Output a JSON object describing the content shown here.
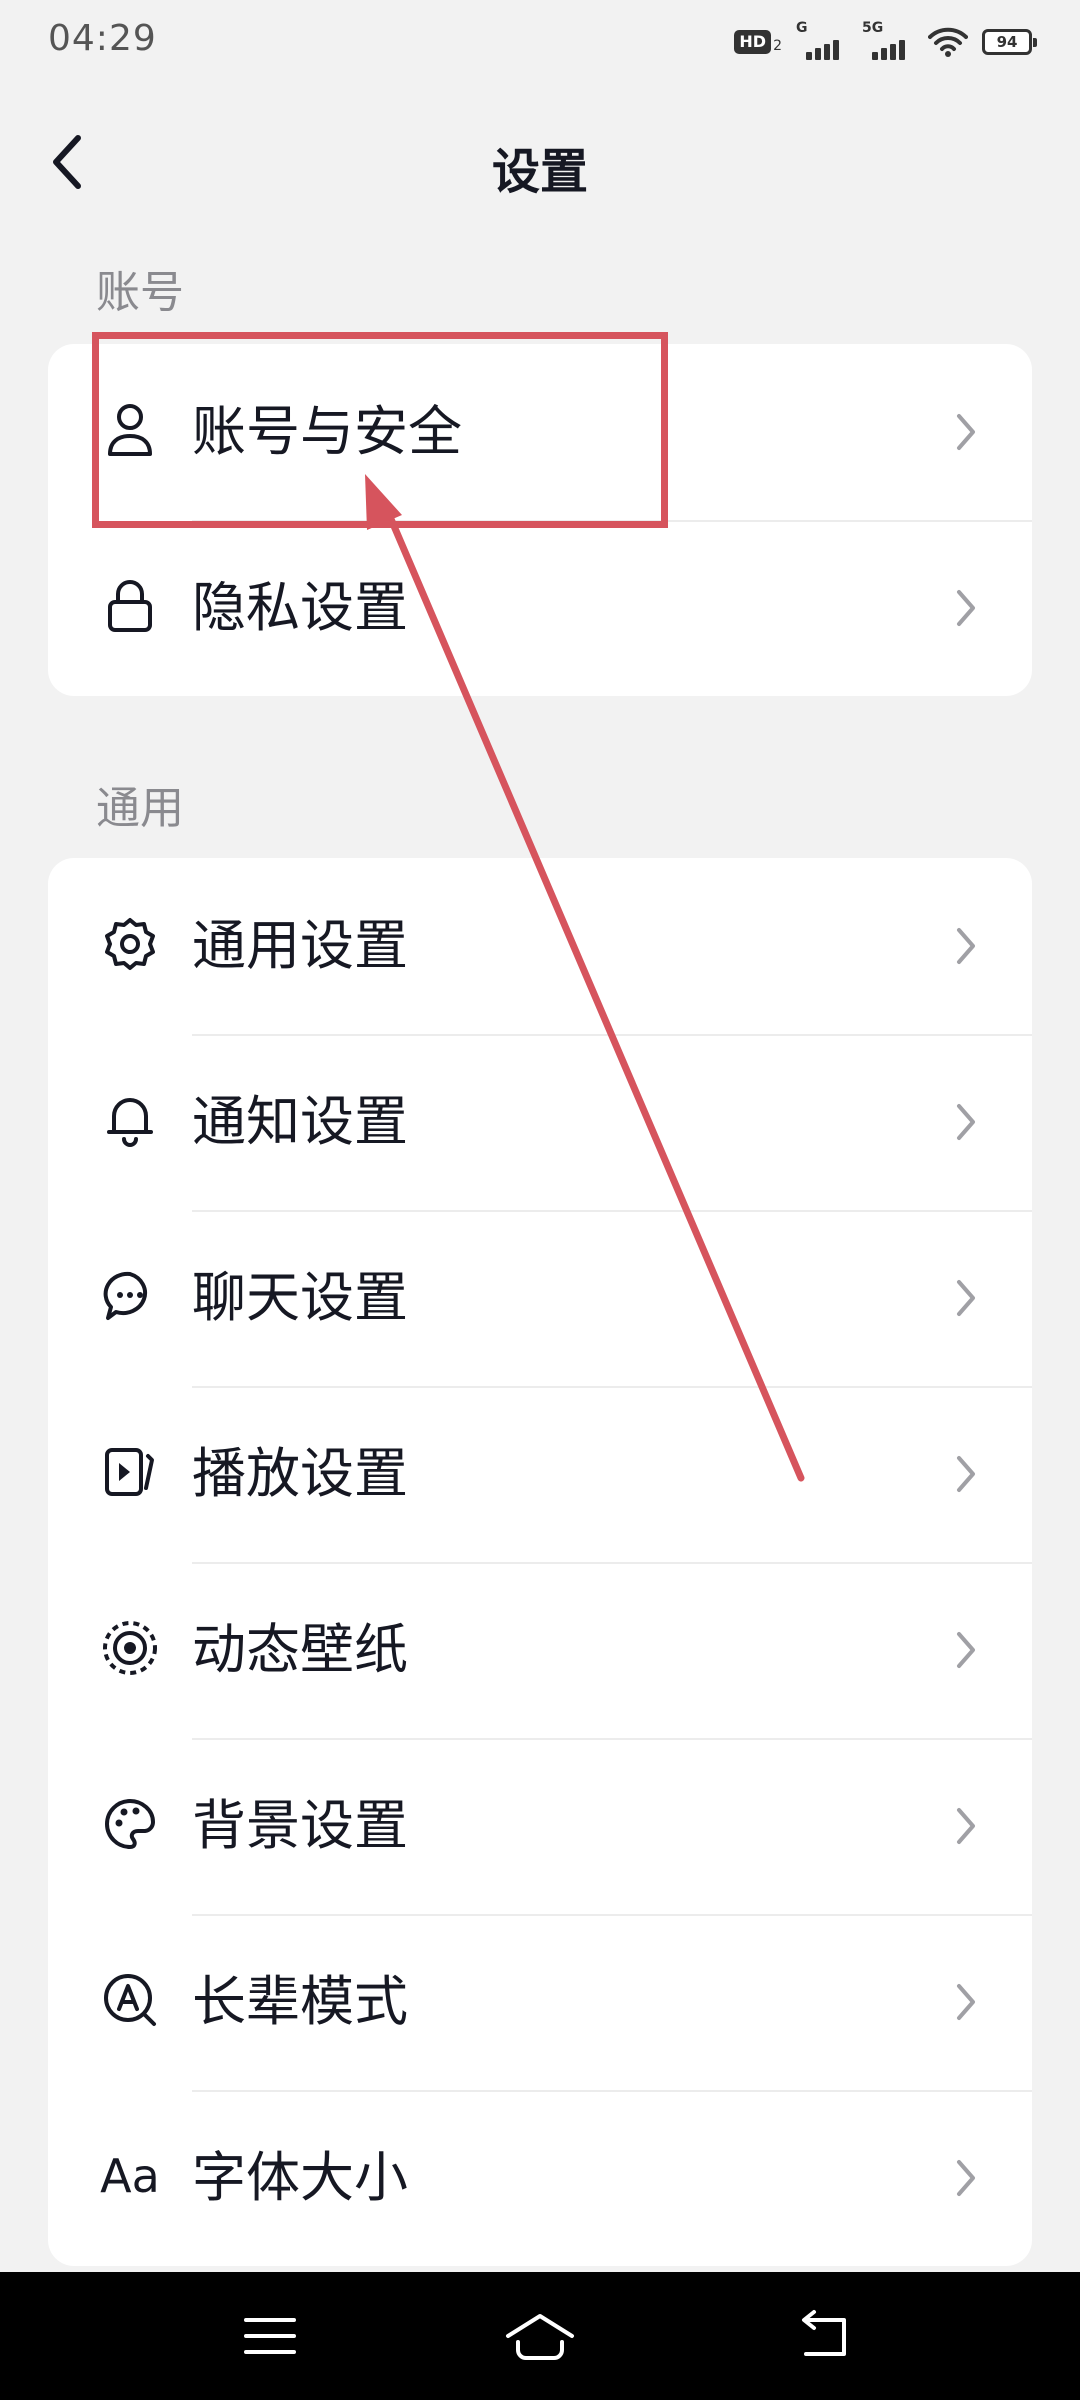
{
  "status_bar": {
    "time": "04:29",
    "hd_label": "HD",
    "hd_sub": "2",
    "sig1_label": "G",
    "sig2_label": "5G",
    "battery": "94"
  },
  "header": {
    "title": "设置"
  },
  "sections": {
    "account": {
      "title": "账号",
      "items": [
        {
          "label": "账号与安全",
          "icon": "user-icon"
        },
        {
          "label": "隐私设置",
          "icon": "lock-icon"
        }
      ]
    },
    "general": {
      "title": "通用",
      "items": [
        {
          "label": "通用设置",
          "icon": "gear-icon"
        },
        {
          "label": "通知设置",
          "icon": "bell-icon"
        },
        {
          "label": "聊天设置",
          "icon": "chat-bubble-icon"
        },
        {
          "label": "播放设置",
          "icon": "play-icon"
        },
        {
          "label": "动态壁纸",
          "icon": "live-wallpaper-icon"
        },
        {
          "label": "背景设置",
          "icon": "palette-icon"
        },
        {
          "label": "长辈模式",
          "icon": "elder-mode-icon"
        },
        {
          "label": "字体大小",
          "icon": "font-size-icon",
          "icon_text": "Aa"
        }
      ]
    }
  },
  "colors": {
    "annotation": "#d6545d",
    "background": "#f2f2f2",
    "card": "#ffffff",
    "text": "#161823"
  }
}
